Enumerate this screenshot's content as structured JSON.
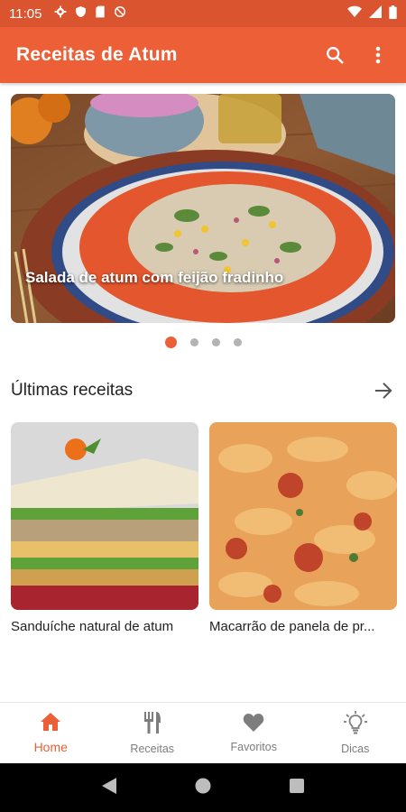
{
  "status_bar": {
    "time": "11:05",
    "icons_left": [
      "settings-icon",
      "shield-icon",
      "sd-card-icon",
      "no-sync-icon"
    ],
    "icons_right": [
      "wifi-icon",
      "signal-icon",
      "battery-icon"
    ]
  },
  "app_bar": {
    "title": "Receitas de Atum",
    "actions": [
      "search-icon",
      "more-vert-icon"
    ]
  },
  "carousel": {
    "title": "Salada de atum com feijão fradinho",
    "total_slides": 4,
    "active_slide": 1
  },
  "section": {
    "title": "Últimas receitas"
  },
  "recipes": [
    {
      "title": "Sanduíche natural de atum"
    },
    {
      "title": "Macarrão de panela de pr..."
    }
  ],
  "bottom_nav": {
    "items": [
      {
        "label": "Home",
        "icon": "home-icon",
        "active": true
      },
      {
        "label": "Receitas",
        "icon": "fork-knife-icon",
        "active": false
      },
      {
        "label": "Favoritos",
        "icon": "heart-icon",
        "active": false
      },
      {
        "label": "Dicas",
        "icon": "lightbulb-icon",
        "active": false
      }
    ]
  },
  "colors": {
    "primary": "#ec5f37",
    "status_bar": "#d9542f",
    "inactive": "#7d7d7d"
  }
}
